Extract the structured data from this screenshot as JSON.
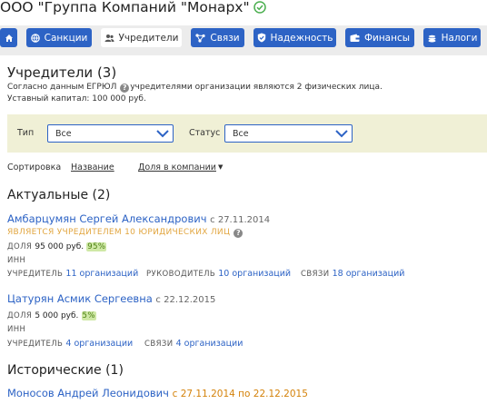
{
  "header": {
    "company_title": "ООО \"Группа Компаний \"Монарх\""
  },
  "tabs": [
    {
      "label": ""
    },
    {
      "label": "Санкции"
    },
    {
      "label": "Учредители"
    },
    {
      "label": "Связи"
    },
    {
      "label": "Надежность"
    },
    {
      "label": "Финансы"
    },
    {
      "label": "Налоги"
    }
  ],
  "section": {
    "title": "Учредители (3)",
    "description_part1": "Согласно данным ЕГРЮЛ",
    "description_part2": "учредителями организации являются 2 физических лица.",
    "capital": "Уставный капитал: 100 000 руб."
  },
  "filters": {
    "type_label": "Тип",
    "type_value": "Все",
    "status_label": "Статус",
    "status_value": "Все"
  },
  "sorting": {
    "label": "Сортировка",
    "by_name": "Название",
    "by_share": "Доля в компании"
  },
  "current": {
    "title": "Актуальные (2)",
    "founders": [
      {
        "name": "Амбарцумян Сергей Александрович",
        "since": "с 27.11.2014",
        "warning": "ЯВЛЯЕТСЯ УЧРЕДИТЕЛЕМ 10 ЮРИДИЧЕСКИХ ЛИЦ",
        "share_label": "ДОЛЯ",
        "share_value": "95 000 руб.",
        "share_pct": "95%",
        "inn_label": "ИНН",
        "founder_label": "УЧРЕДИТЕЛЬ",
        "founder_link": "11 организаций",
        "head_label": "РУКОВОДИТЕЛЬ",
        "head_link": "10 организаций",
        "links_label": "СВЯЗИ",
        "links_link": "18 организаций"
      },
      {
        "name": "Цатурян Асмик Сергеевна",
        "since": "с 22.12.2015",
        "share_label": "ДОЛЯ",
        "share_value": "5 000 руб.",
        "share_pct": "5%",
        "inn_label": "ИНН",
        "founder_label": "УЧРЕДИТЕЛЬ",
        "founder_link": "4 организации",
        "links_label": "СВЯЗИ",
        "links_link": "4 организации"
      }
    ]
  },
  "historical": {
    "title": "Исторические (1)",
    "founders": [
      {
        "name": "Моносов Андрей Леонидович",
        "period": "с 27.11.2014 по 22.12.2015"
      }
    ]
  },
  "colors": {
    "accent": "#2d63c5",
    "warning": "#e2a640",
    "history_date": "#d4820a",
    "filter_bg": "#f0f0d6",
    "pct_bg": "#cfe8a6"
  }
}
